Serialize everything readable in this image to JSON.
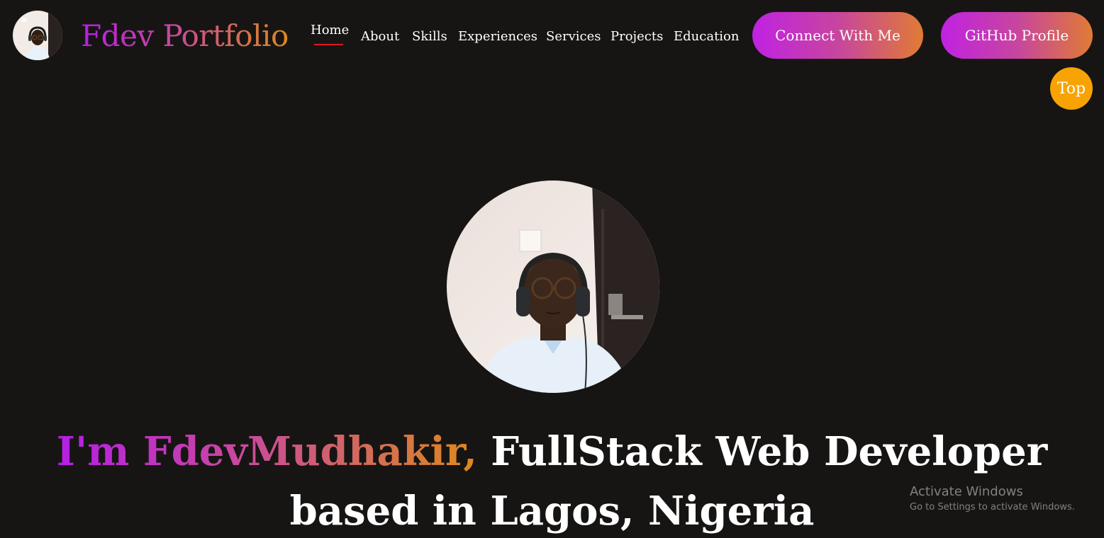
{
  "header": {
    "brand": "Fdev Portfolio",
    "nav": [
      {
        "label": "Home",
        "active": true
      },
      {
        "label": "About"
      },
      {
        "label": "Skills"
      },
      {
        "label": "Experiences"
      },
      {
        "label": "Services"
      },
      {
        "label": "Projects"
      },
      {
        "label": "Education"
      }
    ],
    "connect_button": "Connect With Me",
    "github_button": "GitHub Profile"
  },
  "top_button": "Top",
  "hero": {
    "headline_highlight": "I'm FdevMudhakir,",
    "headline_rest": " FullStack Web Developer based in Lagos, Nigeria"
  },
  "watermark": {
    "title": "Activate Windows",
    "subtitle": "Go to Settings to activate Windows."
  },
  "colors": {
    "background": "#171514",
    "gradient_start": "#b61ee6",
    "gradient_mid": "#c94a9b",
    "gradient_end": "#dd8a1c",
    "nav_active_underline": "#e01a1a",
    "top_button": "#f8a304"
  }
}
